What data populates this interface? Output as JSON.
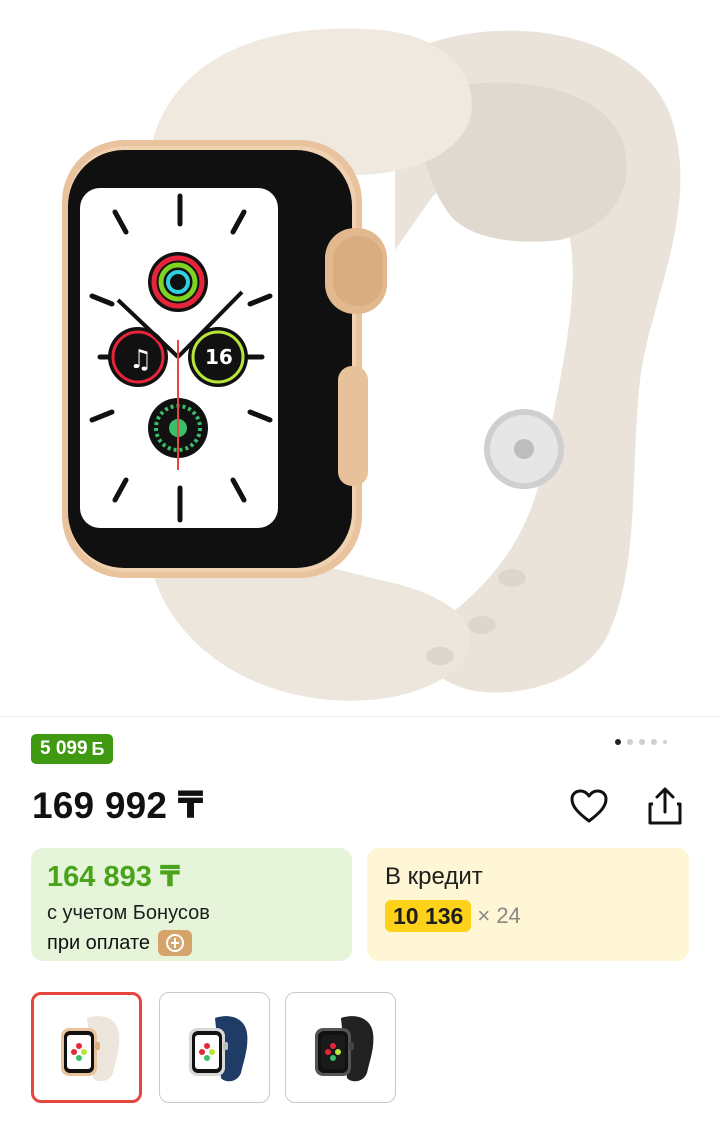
{
  "product": {
    "image_icon": "apple-watch-se-gold-starlight-image"
  },
  "gallery": {
    "pages_total": 5,
    "active_index": 0
  },
  "bonus_badge": {
    "amount": "5 099",
    "currency_sign": "Б"
  },
  "price": {
    "value": "169 992 ₸"
  },
  "actions": {
    "favorite_icon": "heart-icon",
    "share_icon": "share-icon"
  },
  "bonus_offer": {
    "price": "164 893 ₸",
    "note_line1": "с учетом Бонусов",
    "note_line2": "при оплате",
    "payment_icon": "kaspi-pay-icon"
  },
  "credit_offer": {
    "title": "В кредит",
    "monthly_amount": "10 136",
    "term": "× 24"
  },
  "variants": [
    {
      "name": "starlight-gold",
      "band_color": "#ece6dc",
      "case_color": "#e8c39e",
      "selected": true
    },
    {
      "name": "abyss-blue-silver",
      "band_color": "#1f3c66",
      "case_color": "#d8d8d8",
      "selected": false
    },
    {
      "name": "midnight-space-gray",
      "band_color": "#222222",
      "case_color": "#555555",
      "selected": false
    }
  ],
  "colors": {
    "bonus_green": "#3f9a12",
    "bonus_price_green": "#49a31b",
    "bonus_card_bg": "#e6f5da",
    "credit_card_bg": "#fff6d6",
    "credit_highlight": "#ffd21a",
    "selected_border": "#e5463d"
  }
}
